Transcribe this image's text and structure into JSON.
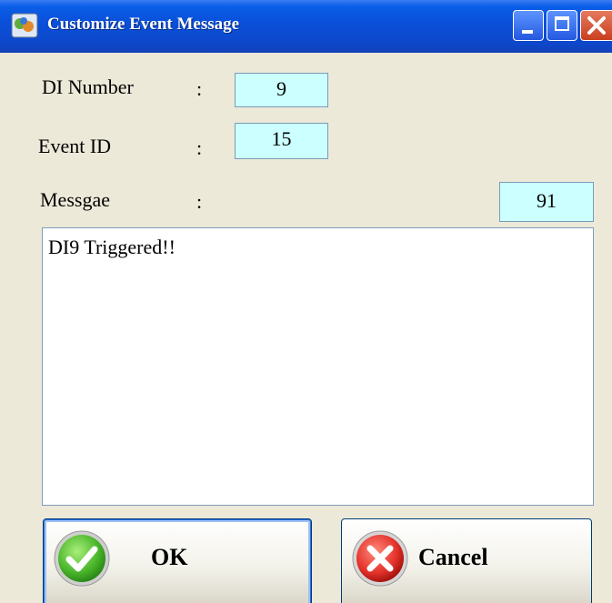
{
  "window": {
    "title": "Customize Event Message",
    "icon": "app-icon",
    "controls": [
      "minimize-icon",
      "maximize-icon",
      "close-icon"
    ]
  },
  "form": {
    "di_number": {
      "label": "DI Number",
      "colon": ":",
      "value": "9"
    },
    "event_id": {
      "label": "Event ID",
      "colon": ":",
      "value": "15"
    },
    "message": {
      "label": "Messgae",
      "colon": ":",
      "length": "91",
      "text": "DI9 Triggered!!"
    }
  },
  "buttons": {
    "ok": {
      "label": "OK",
      "icon": "check-icon"
    },
    "cancel": {
      "label": "Cancel",
      "icon": "x-icon"
    }
  },
  "colors": {
    "titlebar": "#0a4fd8",
    "value_box": "#ccffff",
    "window_bg": "#ece9d8",
    "ok_green": "#5cc23a",
    "cancel_red": "#e8322c"
  }
}
